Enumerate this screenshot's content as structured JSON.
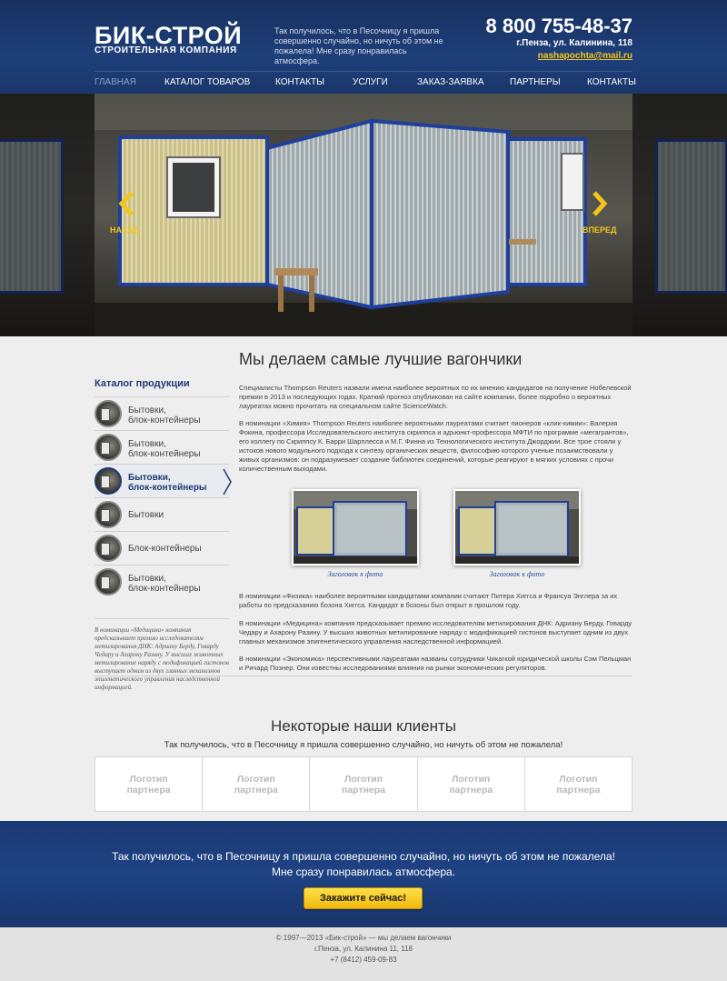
{
  "header": {
    "logo_title": "БИК-СТРОЙ",
    "logo_subtitle": "СТРОИТЕЛЬНАЯ КОМПАНИЯ",
    "tagline": "Так получилось, что в Песочницу я пришла совершенно случайно, но ничуть об этом не пожалела! Мне сразу понравилась атмосфера.",
    "phone": "8 800 755-48-37",
    "address": "г.Пенза, ул. Калинина, 118",
    "email": "nashapochta@mail.ru"
  },
  "nav": {
    "items": [
      "ГЛАВНАЯ",
      "КАТАЛОГ ТОВАРОВ",
      "КОНТАКТЫ",
      "УСЛУГИ",
      "ЗАКАЗ-ЗАЯВКА",
      "ПАРТНЕРЫ",
      "КОНТАКТЫ"
    ],
    "active_index": 0
  },
  "slider": {
    "prev_label": "НАЗАД",
    "next_label": "ВПЕРЕД"
  },
  "sidebar": {
    "title": "Каталог продукции",
    "items": [
      {
        "line1": "Бытовки,",
        "line2": "блок-контейнеры"
      },
      {
        "line1": "Бытовки,",
        "line2": "блок-контейнеры"
      },
      {
        "line1": "Бытовки,",
        "line2": "блок-контейнеры"
      },
      {
        "line1": "Бытовки",
        "line2": ""
      },
      {
        "line1": "Блок-контейнеры",
        "line2": ""
      },
      {
        "line1": "Бытовки,",
        "line2": "блок-контейнеры"
      }
    ],
    "active_index": 2,
    "note": "В номинации «Медицина» компания предсказывает премию исследователям метилирования ДНК: Адриану Берду, Говарду Чедару и Ахарону Разину. У высших животных метилирование наряду с модификацией гистонов выступает одним из двух главных механизмов эпигенетического управления наследственной информацией."
  },
  "main": {
    "title": "Мы делаем самые лучшие вагончики",
    "paragraphs": [
      "Специалисты Thompson Reuters назвали имена наиболее вероятных по их мнению кандидатов на получение Нобелевской премии в 2013 и последующих годах. Краткий прогноз опубликован на сайте компании, более подробно о вероятных лауреатах можно прочитать на специальном сайте ScienceWatch.",
      "В номинации «Химия» Thompson Reuters наиболее вероятными лауреатами считает пионеров «клик-химии»: Валерия Фокина, профессора Исследовательского института скриппса и адъюнкт-профессора МФТИ по программе «мегагрантов», его коллегу по Скриппсу К. Барри Шарплесса и М.Г. Финна из Технологического института Джорджии. Все трое стояли у истоков нового модульного подхода к синтезу органических веществ, философию которого ученые позаимствовали у живых организмов: он подразумевает создание библиотек соединений, которые реагируют в мягких условиях с прочи количественным выходами.",
      "В номинации «Физика» наиболее вероятными кандидатами компании считают Питера Хиггса и Франсуа Энглера за их работы по предсказанию бозона Хиггса. Кандидат в бозоны был открыт в прошлом году.",
      "В номинации «Медицина» компания предсказывает премию исследователям метилирования ДНК: Адриану Берду, Говарду Чедару и Ахарону Разину. У высших животных метилирование наряду с модификацией гистонов выступает одним из двух главных механизмов эпигенетического управления наследственной информацией.",
      "В номинации «Экономика» перспективными лауреатами названы сотрудники Чикагкой юридической школы Сэм Пельцман и Ричард Познер. Они известны исследованиями влияния на рынки экономических регуляторов."
    ],
    "photos": [
      {
        "caption": "Заголовок к фото"
      },
      {
        "caption": "Заголовок к фото"
      }
    ]
  },
  "clients": {
    "title": "Некоторые наши клиенты",
    "subtitle": "Так получилось, что в Песочницу я пришла совершенно случайно, но ничуть об этом не пожалела!",
    "logos": [
      {
        "line1": "Логотип",
        "line2": "партнера"
      },
      {
        "line1": "Логотип",
        "line2": "партнера"
      },
      {
        "line1": "Логотип",
        "line2": "партнера"
      },
      {
        "line1": "Логотип",
        "line2": "партнера"
      },
      {
        "line1": "Логотип",
        "line2": "партнера"
      }
    ]
  },
  "cta": {
    "line1": "Так получилось, что в Песочницу я пришла совершенно случайно, но ничуть об этом не пожалела!",
    "line2": "Мне сразу понравилась атмосфера.",
    "button": "Закажите сейчас!"
  },
  "footer": {
    "copyright": "© 1997—2013 «Бик-строй» — мы делаем вагончики",
    "address": "г.Пенза, ул. Калинина 11, 118",
    "phone": "+7 (8412) 459-09-83"
  },
  "colors": {
    "brand_blue": "#1e3f79",
    "accent_yellow": "#f3c61c",
    "cta_button": "#f1b80c"
  }
}
